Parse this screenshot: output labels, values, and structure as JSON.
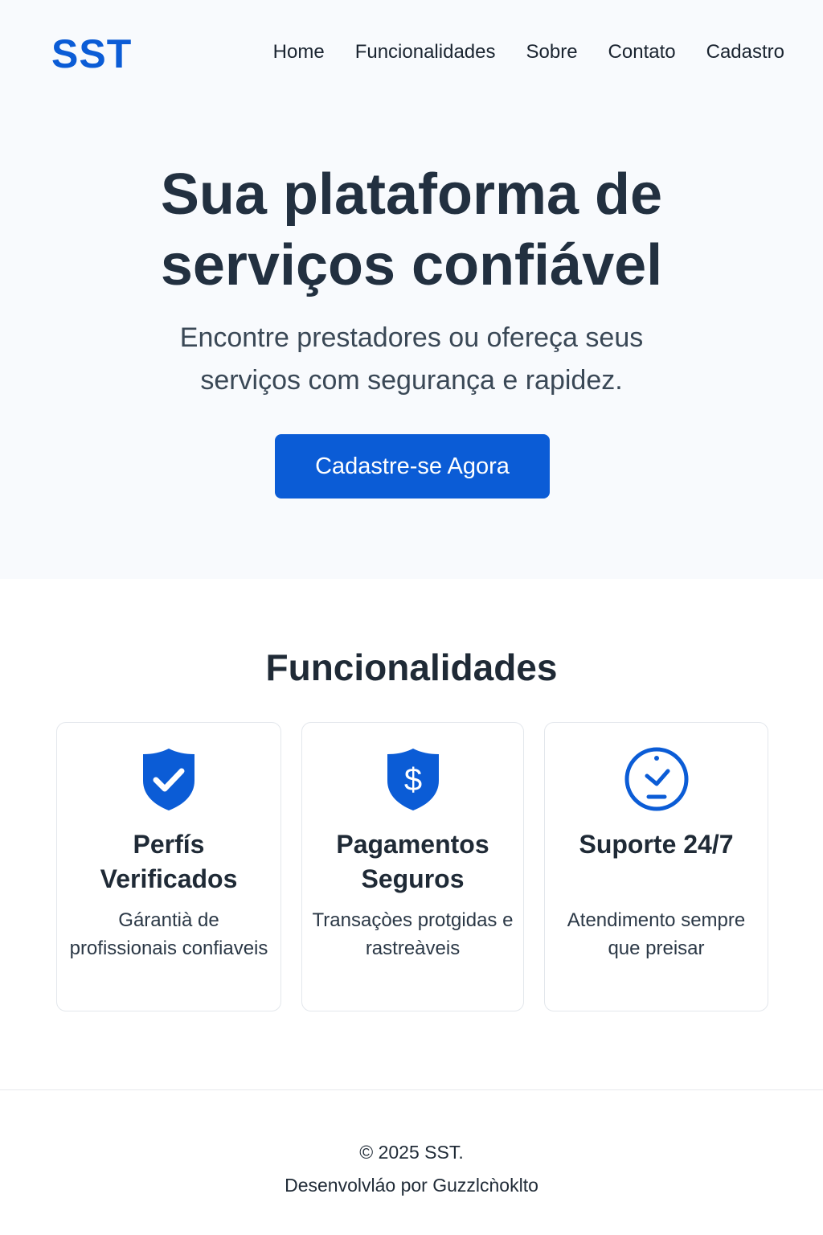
{
  "header": {
    "logo": "SST",
    "nav": [
      "Home",
      "Funcionalidades",
      "Sobre",
      "Contato",
      "Cadastro"
    ]
  },
  "hero": {
    "title": "Sua plataforma de serviços confiável",
    "subtitle": "Encontre prestadores ou ofereça seus serviços com segurança e rapidez.",
    "cta_label": "Cadastre-se Agora"
  },
  "features": {
    "title": "Funcionalidades",
    "cards": [
      {
        "icon": "shield-check-icon",
        "title": "Perfís Verificados",
        "desc": "Gárantià de profissionais confiaveis"
      },
      {
        "icon": "shield-dollar-icon",
        "title": "Pagamentos Seguros",
        "desc": "Transaçòes protgidas e rastreàveis"
      },
      {
        "icon": "clock-icon",
        "title": "Suporte 24/7",
        "desc": "Atendimento sempre que preisar"
      }
    ]
  },
  "footer": {
    "copyright": "© 2025 SST.",
    "developer": "Desenvolvláo por Guzzlcǹoklto"
  },
  "colors": {
    "accent": "#0b5cd6",
    "hero_bg": "#f8fafd",
    "heading": "#223040"
  }
}
